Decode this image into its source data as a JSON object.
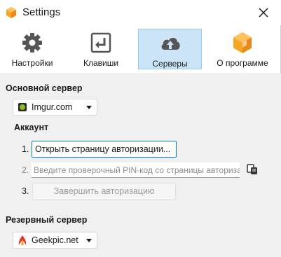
{
  "window": {
    "title": "Settings",
    "close_icon": "close-icon"
  },
  "tabs": [
    {
      "label": "Настройки",
      "icon": "gear-icon",
      "active": false
    },
    {
      "label": "Клавиши",
      "icon": "enter-key-icon",
      "active": false
    },
    {
      "label": "Серверы",
      "icon": "cloud-upload-icon",
      "active": true
    },
    {
      "label": "О программе",
      "icon": "app-logo-icon",
      "active": false
    }
  ],
  "primary_server": {
    "title": "Основной сервер",
    "selected": "Imgur.com",
    "icon": "imgur-icon"
  },
  "account": {
    "title": "Аккаунт",
    "step1_num": "1.",
    "step1_button": "Открыть страницу авторизации...",
    "step2_num": "2.",
    "step2_placeholder": "Введите проверочный PIN-код со страницы авторизации",
    "step2_value": "",
    "paste_icon": "paste-icon",
    "step3_num": "3.",
    "step3_button": "Завершить авторизацию"
  },
  "backup_server": {
    "title": "Резервный сервер",
    "selected": "Geekpic.net",
    "icon": "geekpic-icon"
  },
  "colors": {
    "accent": "#0078d7",
    "active_tab_bg": "#cce4f7",
    "content_bg": "#f0f0f0",
    "logo_orange": "#f5a623",
    "imgur_green": "#85bf25",
    "geekpic_red": "#e8321e"
  }
}
